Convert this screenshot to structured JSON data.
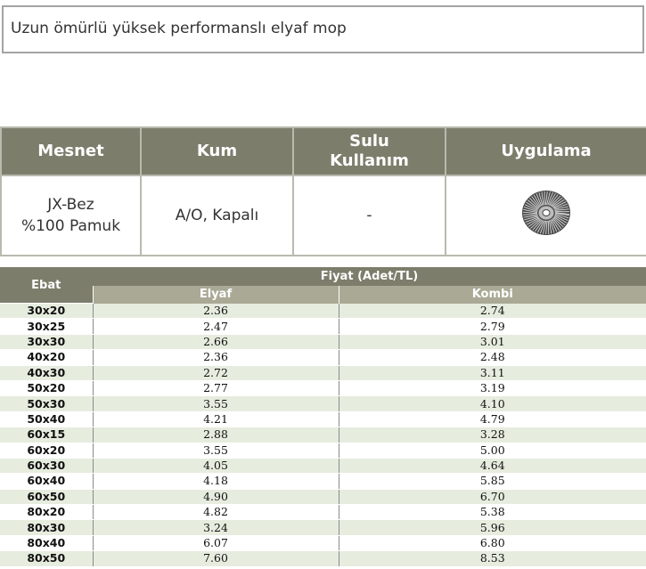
{
  "product": {
    "description": "Uzun ömürlü yüksek performanslı elyaf mop"
  },
  "spec_table": {
    "headers": {
      "mesnet": "Mesnet",
      "kum": "Kum",
      "sulu_line1": "Sulu",
      "sulu_line2": "Kullanım",
      "uygulama": "Uygulama"
    },
    "row": {
      "mesnet_line1": "JX-Bez",
      "mesnet_line2": "%100 Pamuk",
      "kum": "A/O, Kapalı",
      "sulu": "-",
      "uygulama_icon": "flap-mop-wheel-icon"
    }
  },
  "price_table": {
    "header_size": "Ebat",
    "header_price": "Fiyat (Adet/TL)",
    "col_elyaf": "Elyaf",
    "col_kombi": "Kombi",
    "rows": [
      {
        "size": "30x20",
        "elyaf": "2.36",
        "kombi": "2.74"
      },
      {
        "size": "30x25",
        "elyaf": "2.47",
        "kombi": "2.79"
      },
      {
        "size": "30x30",
        "elyaf": "2.66",
        "kombi": "3.01"
      },
      {
        "size": "40x20",
        "elyaf": "2.36",
        "kombi": "2.48"
      },
      {
        "size": "40x30",
        "elyaf": "2.72",
        "kombi": "3.11"
      },
      {
        "size": "50x20",
        "elyaf": "2.77",
        "kombi": "3.19"
      },
      {
        "size": "50x30",
        "elyaf": "3.55",
        "kombi": "4.10"
      },
      {
        "size": "50x40",
        "elyaf": "4.21",
        "kombi": "4.79"
      },
      {
        "size": "60x15",
        "elyaf": "2.88",
        "kombi": "3.28"
      },
      {
        "size": "60x20",
        "elyaf": "3.55",
        "kombi": "5.00"
      },
      {
        "size": "60x30",
        "elyaf": "4.05",
        "kombi": "4.64"
      },
      {
        "size": "60x40",
        "elyaf": "4.18",
        "kombi": "5.85"
      },
      {
        "size": "60x50",
        "elyaf": "4.90",
        "kombi": "6.70"
      },
      {
        "size": "80x20",
        "elyaf": "4.82",
        "kombi": "5.38"
      },
      {
        "size": "80x30",
        "elyaf": "3.24",
        "kombi": "5.96"
      },
      {
        "size": "80x40",
        "elyaf": "6.07",
        "kombi": "6.80"
      },
      {
        "size": "80x50",
        "elyaf": "7.60",
        "kombi": "8.53"
      }
    ]
  },
  "colors": {
    "header_bg": "#7d7d6c",
    "subheader_bg": "#a9a995",
    "stripe_bg": "#e6eddf"
  }
}
